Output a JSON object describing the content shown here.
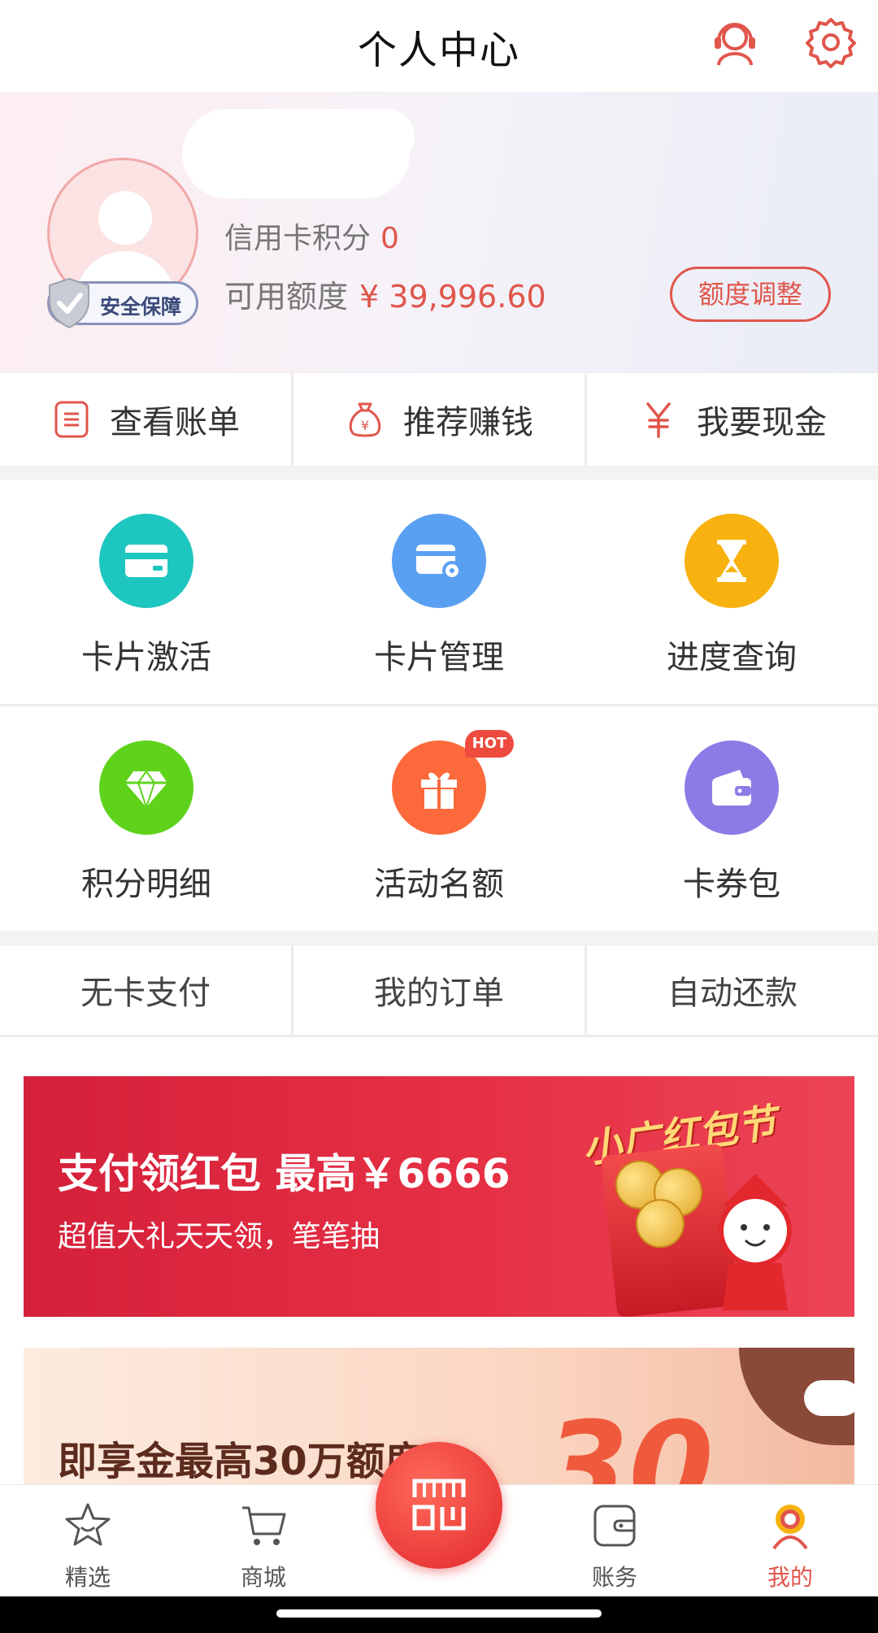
{
  "header": {
    "title": "个人中心"
  },
  "profile": {
    "points_label": "信用卡积分",
    "points_value": "0",
    "credit_label": "可用额度",
    "credit_value": "¥ 39,996.60",
    "security_badge": "安全保障",
    "adjust_button": "额度调整"
  },
  "quick_actions": [
    {
      "label": "查看账单",
      "icon": "bill-icon"
    },
    {
      "label": "推荐赚钱",
      "icon": "money-bag-icon"
    },
    {
      "label": "我要现金",
      "icon": "yuan-icon"
    }
  ],
  "grid": [
    {
      "label": "卡片激活",
      "icon": "card-icon",
      "color": "#1ec6c0"
    },
    {
      "label": "卡片管理",
      "icon": "card-settings-icon",
      "color": "#5aa0f2"
    },
    {
      "label": "进度查询",
      "icon": "hourglass-icon",
      "color": "#f7b20f"
    },
    {
      "label": "积分明细",
      "icon": "diamond-icon",
      "color": "#5fd31c"
    },
    {
      "label": "活动名额",
      "icon": "gift-icon",
      "color": "#fc6a3c"
    },
    {
      "label": "卡券包",
      "icon": "wallet-icon",
      "color": "#8b7be6"
    }
  ],
  "hot_badge": "HOT",
  "links": [
    "无卡支付",
    "我的订单",
    "自动还款"
  ],
  "banner1": {
    "title": "支付领红包 最高￥6666",
    "subtitle": "超值大礼天天领，笔笔抽",
    "festival": "小广红包节"
  },
  "banner2": {
    "title": "即享金最高30万额度",
    "big_number": "30"
  },
  "tabbar": [
    {
      "label": "精选",
      "icon": "star-icon",
      "active": false
    },
    {
      "label": "商城",
      "icon": "cart-icon",
      "active": false
    },
    {
      "label": "",
      "icon": "scan-icon",
      "active": false
    },
    {
      "label": "账务",
      "icon": "wallet-tab-icon",
      "active": false
    },
    {
      "label": "我的",
      "icon": "user-tab-icon",
      "active": true
    }
  ],
  "colors": {
    "accent": "#e0564c"
  }
}
